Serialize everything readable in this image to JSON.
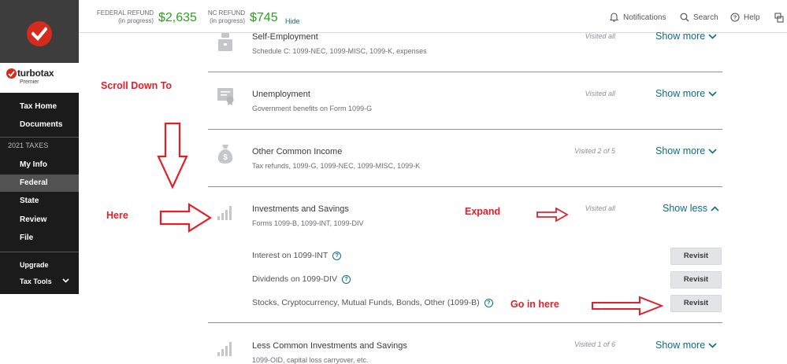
{
  "brand": {
    "name": "turbotax",
    "tier": "Premier"
  },
  "sidebar": {
    "top_items": [
      {
        "label": "Tax Home"
      },
      {
        "label": "Documents"
      }
    ],
    "section_label": "2021 TAXES",
    "items": [
      {
        "label": "My Info"
      },
      {
        "label": "Federal",
        "active": true
      },
      {
        "label": "State"
      },
      {
        "label": "Review"
      },
      {
        "label": "File"
      }
    ],
    "bottom_items": [
      {
        "label": "Upgrade"
      },
      {
        "label": "Tax Tools"
      }
    ]
  },
  "header": {
    "federal_label": "FEDERAL REFUND",
    "federal_status": "(in progress)",
    "federal_amount": "$2,635",
    "nc_label": "NC REFUND",
    "nc_status": "(in progress)",
    "nc_amount": "$745",
    "hide_label": "Hide",
    "notifications_label": "Notifications",
    "search_label": "Search",
    "help_label": "Help"
  },
  "rows": [
    {
      "title": "Self-Employment",
      "subtitle": "Schedule C: 1099-NEC, 1099-MISC, 1099-K, expenses",
      "visited": "Visited all",
      "toggle": "Show more",
      "icon": "briefcase-icon"
    },
    {
      "title": "Unemployment",
      "subtitle": "Government benefits on Form 1099-G",
      "visited": "Visited all",
      "toggle": "Show more",
      "icon": "certificate-icon"
    },
    {
      "title": "Other Common Income",
      "subtitle": "Tax refunds, 1099-G, 1099-NEC, 1099-MISC, 1099-K",
      "visited": "Visited 2 of 5",
      "toggle": "Show more",
      "icon": "money-bag-icon"
    },
    {
      "title": "Investments and Savings",
      "subtitle": "Forms 1099-B, 1099-INT, 1099-DIV",
      "visited": "Visited all",
      "toggle": "Show less",
      "icon": "bar-chart-icon"
    },
    {
      "title": "Less Common Investments and Savings",
      "subtitle": "1099-OID, capital loss carryover, etc.",
      "visited": "Visited 1 of 6",
      "toggle": "Show more",
      "icon": "bar-chart-icon"
    }
  ],
  "sub_items": [
    {
      "label": "Interest on 1099-INT",
      "button": "Revisit"
    },
    {
      "label": "Dividends on 1099-DIV",
      "button": "Revisit"
    },
    {
      "label": "Stocks, Cryptocurrency, Mutual Funds, Bonds, Other (1099-B)",
      "button": "Revisit"
    }
  ],
  "annotations": {
    "scroll_down": "Scroll Down To",
    "here": "Here",
    "expand": "Expand",
    "go_in": "Go in here"
  },
  "colors": {
    "accent": "#0d6e8a",
    "refund": "#2ca01c",
    "brand_red": "#d52b1e",
    "annotation": "#e3202a"
  }
}
